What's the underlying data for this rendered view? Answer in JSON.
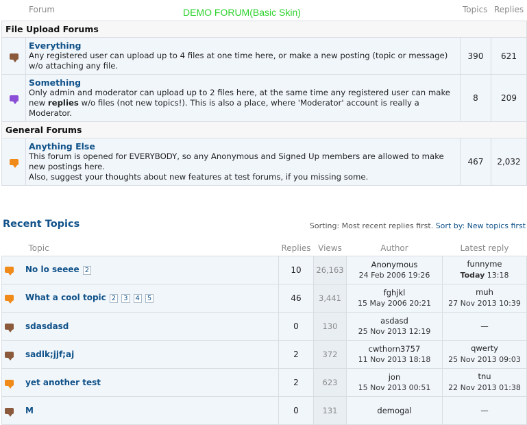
{
  "header": {
    "forum_col": "Forum",
    "site_title": "DEMO FORUM(Basic Skin)",
    "topics_col": "Topics",
    "replies_col": "Replies"
  },
  "categories": [
    {
      "name": "File Upload Forums",
      "forums": [
        {
          "title": "Everything",
          "desc": "Any registered user can upload up to 4 files at one time here, or make a new posting (topic or message) w/o attaching any file.",
          "topics": "390",
          "replies": "621",
          "icon": "chat-bubble-brown-icon"
        },
        {
          "title": "Something",
          "desc_before": "Only admin and moderator can upload up to 2 files here, at the same time any registered user can make new ",
          "desc_bold": "replies",
          "desc_after": " w/o files (not new topics!). This is also a place, where 'Moderator' account is really a Moderator.",
          "topics": "8",
          "replies": "209",
          "icon": "chat-bubble-purple-icon"
        }
      ]
    },
    {
      "name": "General Forums",
      "forums": [
        {
          "title": "Anything Else",
          "desc_line1": "This forum is opened for EVERYBODY, so any Anonymous and Signed Up members are allowed to make new postings here.",
          "desc_line2": "Also, suggest your thoughts about new features at test forums, if you missing some.",
          "topics": "467",
          "replies": "2,032",
          "icon": "chat-bubble-orange-icon"
        }
      ]
    }
  ],
  "recent": {
    "title": "Recent Topics",
    "sorting_label": "Sorting: Most recent replies first.",
    "sort_by_label": "Sort by:",
    "sort_link": "New topics first",
    "columns": {
      "topic": "Topic",
      "replies": "Replies",
      "views": "Views",
      "author": "Author",
      "latest": "Latest reply"
    },
    "topics": [
      {
        "title": "No lo seeee",
        "pages": [
          "2"
        ],
        "replies": "10",
        "views": "26,163",
        "author": "Anonymous",
        "author_date": "24 Feb 2006 19:26",
        "latest_user": "funnyme",
        "latest_bold": "Today",
        "latest_date": "13:18",
        "icon": "orange"
      },
      {
        "title": "What a cool topic",
        "pages": [
          "2",
          "3",
          "4",
          "5"
        ],
        "replies": "46",
        "views": "3,441",
        "author": "fghjkl",
        "author_date": "15 May 2006 20:21",
        "latest_user": "muh",
        "latest_bold": "",
        "latest_date": "27 Nov 2013 10:39",
        "icon": "orange"
      },
      {
        "title": "sdasdasd",
        "pages": [],
        "replies": "0",
        "views": "130",
        "author": "asdasd",
        "author_date": "25 Nov 2013 12:19",
        "latest_user": "—",
        "latest_bold": "",
        "latest_date": "",
        "icon": "brown"
      },
      {
        "title": "sadlk;jjf;aj",
        "pages": [],
        "replies": "2",
        "views": "372",
        "author": "cwthorn3757",
        "author_date": "11 Nov 2013 18:18",
        "latest_user": "qwerty",
        "latest_bold": "",
        "latest_date": "25 Nov 2013 09:03",
        "icon": "brown"
      },
      {
        "title": "yet another test",
        "pages": [],
        "replies": "2",
        "views": "623",
        "author": "jon",
        "author_date": "15 Nov 2013 00:51",
        "latest_user": "tnu",
        "latest_bold": "",
        "latest_date": "22 Nov 2013 01:38",
        "icon": "orange"
      },
      {
        "title": "M",
        "pages": [],
        "replies": "0",
        "views": "131",
        "author": "demogal",
        "author_date": "",
        "latest_user": "—",
        "latest_bold": "",
        "latest_date": "",
        "icon": "brown"
      }
    ]
  }
}
